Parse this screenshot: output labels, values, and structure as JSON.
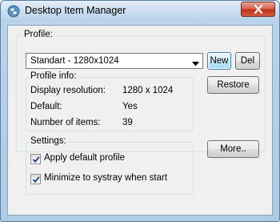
{
  "window": {
    "title": "Desktop Item Manager"
  },
  "profile": {
    "label": "Profile:",
    "selected": "Standart - 1280x1024",
    "new_label": "New",
    "del_label": "Del"
  },
  "profile_info": {
    "label": "Profile info:",
    "rows": [
      {
        "key": "Display resolution:",
        "value": "1280 x 1024"
      },
      {
        "key": "Default:",
        "value": "Yes"
      },
      {
        "key": "Number of items:",
        "value": "39"
      }
    ],
    "restore_label": "Restore"
  },
  "settings": {
    "label": "Settings:",
    "options": [
      {
        "label": "Apply default profile",
        "checked": true
      },
      {
        "label": "Minimize to systray when start",
        "checked": true
      }
    ],
    "more_label": "More.."
  },
  "colors": {
    "accent": "#3c7fb1",
    "close_button": "#c2321c",
    "dialog_background": "#f0f0f0"
  }
}
